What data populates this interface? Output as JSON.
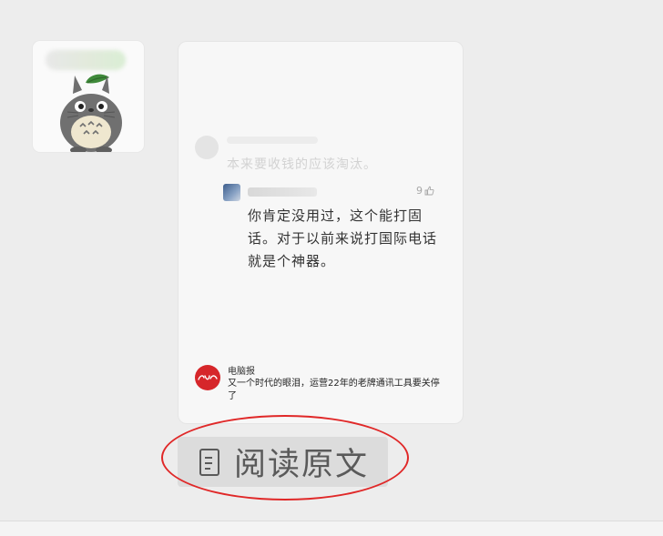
{
  "card": {
    "faded_comment": "本来要收钱的应该淘汰。",
    "reply": {
      "likes": "9",
      "text": "你肯定没用过，这个能打固话。对于以前来说打国际电话就是个神器。"
    },
    "source": {
      "name": "电脑报",
      "headline": "又一个时代的眼泪，运营22年的老牌通讯工具要关停了",
      "logo_color": "#d6262a"
    }
  },
  "read_more": {
    "label": "阅读原文",
    "icon": "document-icon"
  },
  "annotation": {
    "color": "#e02828"
  }
}
